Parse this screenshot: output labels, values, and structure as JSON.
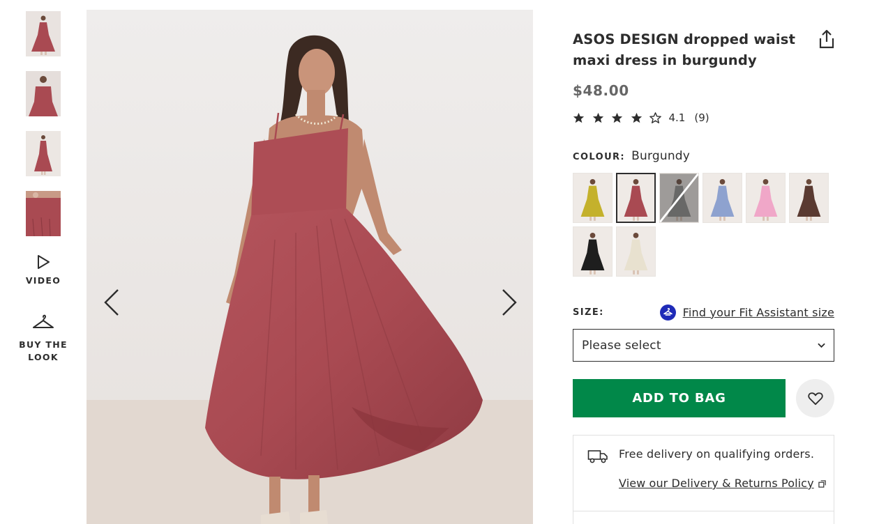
{
  "product": {
    "title": "ASOS DESIGN dropped waist maxi dress in burgundy",
    "price": "$48.00",
    "rating": {
      "stars": 4.1,
      "score": "4.1",
      "count": "(9)"
    },
    "colour_label": "COLOUR:",
    "colour_value": "Burgundy",
    "size_label": "SIZE:",
    "fit_assistant_link": "Find your Fit Assistant size",
    "size_select": {
      "value": "Please select"
    },
    "add_to_bag": "ADD TO BAG"
  },
  "gallery": {
    "video_label": "VIDEO",
    "buy_the_look_label": "BUY THE LOOK"
  },
  "swatches": [
    {
      "name": "mustard",
      "color": "#c4b12c",
      "selected": false,
      "out_of_stock": false
    },
    {
      "name": "burgundy",
      "color": "#a94a52",
      "selected": true,
      "out_of_stock": false
    },
    {
      "name": "grey-print",
      "color": "#8d8c8b",
      "selected": false,
      "out_of_stock": true
    },
    {
      "name": "blue",
      "color": "#8ea2cf",
      "selected": false,
      "out_of_stock": false
    },
    {
      "name": "pink",
      "color": "#f0a7c8",
      "selected": false,
      "out_of_stock": false
    },
    {
      "name": "brown",
      "color": "#5a3a31",
      "selected": false,
      "out_of_stock": false
    },
    {
      "name": "black",
      "color": "#1e1e1e",
      "selected": false,
      "out_of_stock": false
    },
    {
      "name": "floral-print",
      "color": "#e8e1cf",
      "selected": false,
      "out_of_stock": false
    }
  ],
  "delivery": {
    "free_delivery": "Free delivery on qualifying orders.",
    "policy_link": "View our Delivery & Returns Policy"
  },
  "colors": {
    "brand_green": "#018849",
    "text": "#2d2d2d",
    "price_grey": "#666666",
    "fit_icon_blue": "#1f2bb8",
    "dress": "#a94a52"
  },
  "icons": [
    "share-icon",
    "star-icon",
    "play-icon",
    "hanger-icon",
    "chevron-left-icon",
    "chevron-right-icon",
    "chevron-down-icon",
    "heart-icon",
    "truck-icon",
    "external-link-icon",
    "fit-assistant-icon"
  ]
}
